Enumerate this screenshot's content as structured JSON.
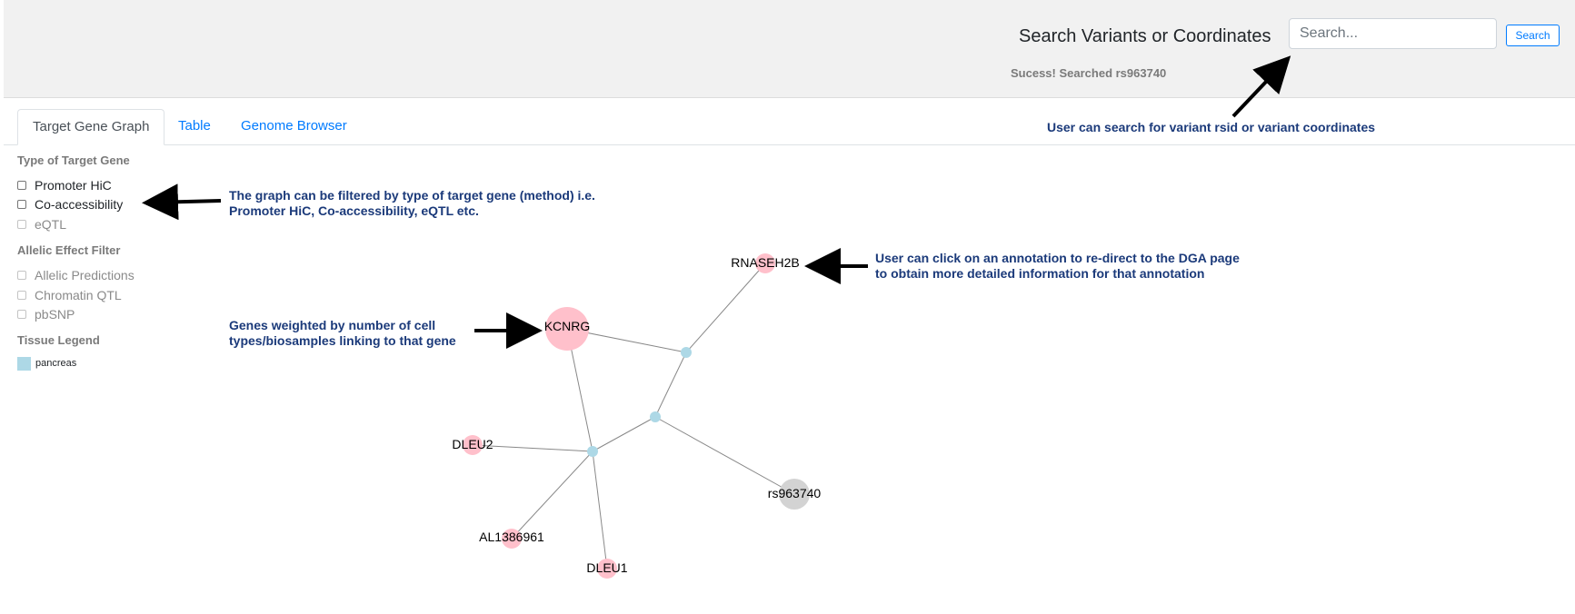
{
  "search": {
    "title": "Search Variants or Coordinates",
    "placeholder": "Search...",
    "value": "",
    "button_label": "Search",
    "status": "Sucess! Searched rs963740"
  },
  "tabs": [
    {
      "label": "Target Gene Graph",
      "active": true
    },
    {
      "label": "Table",
      "active": false
    },
    {
      "label": "Genome Browser",
      "active": false
    }
  ],
  "filters": {
    "target_gene_heading": "Type of Target Gene",
    "target_gene_options": [
      {
        "label": "Promoter HiC",
        "disabled": false,
        "checked": false
      },
      {
        "label": "Co-accessibility",
        "disabled": false,
        "checked": false
      },
      {
        "label": "eQTL",
        "disabled": true,
        "checked": false
      }
    ],
    "allelic_heading": "Allelic Effect Filter",
    "allelic_options": [
      {
        "label": "Allelic Predictions",
        "disabled": true,
        "checked": false
      },
      {
        "label": "Chromatin QTL",
        "disabled": true,
        "checked": false
      },
      {
        "label": "pbSNP",
        "disabled": true,
        "checked": false
      }
    ],
    "tissue_heading": "Tissue Legend",
    "tissue_items": [
      {
        "label": "pancreas",
        "color": "#add8e6"
      }
    ]
  },
  "annotations": {
    "search_note": [
      "User can search for variant rsid or variant coordinates"
    ],
    "filter_note": [
      "The graph can be filtered by type of target gene (method) i.e.",
      "Promoter HiC, Co-accessibility, eQTL etc."
    ],
    "click_note": [
      "User can click on an annotation to re-direct to the DGA page",
      "to obtain more detailed information for that annotation"
    ],
    "weight_note": [
      "Genes weighted by number of cell",
      "types/biosamples linking to that gene"
    ]
  },
  "graph": {
    "colors": {
      "gene": "#ffc0cb",
      "variant": "#d3d3d3",
      "tissue": "#add8e6",
      "edge": "#888888"
    },
    "nodes": [
      {
        "id": "KCNRG",
        "label": "KCNRG",
        "type": "gene"
      },
      {
        "id": "RNASEH2B",
        "label": "RNASEH2B",
        "type": "gene"
      },
      {
        "id": "DLEU2",
        "label": "DLEU2",
        "type": "gene"
      },
      {
        "id": "AL1386961",
        "label": "AL1386961",
        "type": "gene"
      },
      {
        "id": "DLEU1",
        "label": "DLEU1",
        "type": "gene"
      },
      {
        "id": "rs963740",
        "label": "rs963740",
        "type": "variant"
      },
      {
        "id": "hub-upper",
        "label": "",
        "type": "tissue"
      },
      {
        "id": "hub-middle",
        "label": "",
        "type": "tissue"
      },
      {
        "id": "hub-lower",
        "label": "",
        "type": "tissue"
      }
    ],
    "edges": [
      [
        "KCNRG",
        "hub-upper"
      ],
      [
        "RNASEH2B",
        "hub-upper"
      ],
      [
        "hub-upper",
        "hub-middle"
      ],
      [
        "hub-middle",
        "rs963740"
      ],
      [
        "hub-middle",
        "hub-lower"
      ],
      [
        "KCNRG",
        "hub-lower"
      ],
      [
        "DLEU2",
        "hub-lower"
      ],
      [
        "AL1386961",
        "hub-lower"
      ],
      [
        "DLEU1",
        "hub-lower"
      ]
    ]
  }
}
